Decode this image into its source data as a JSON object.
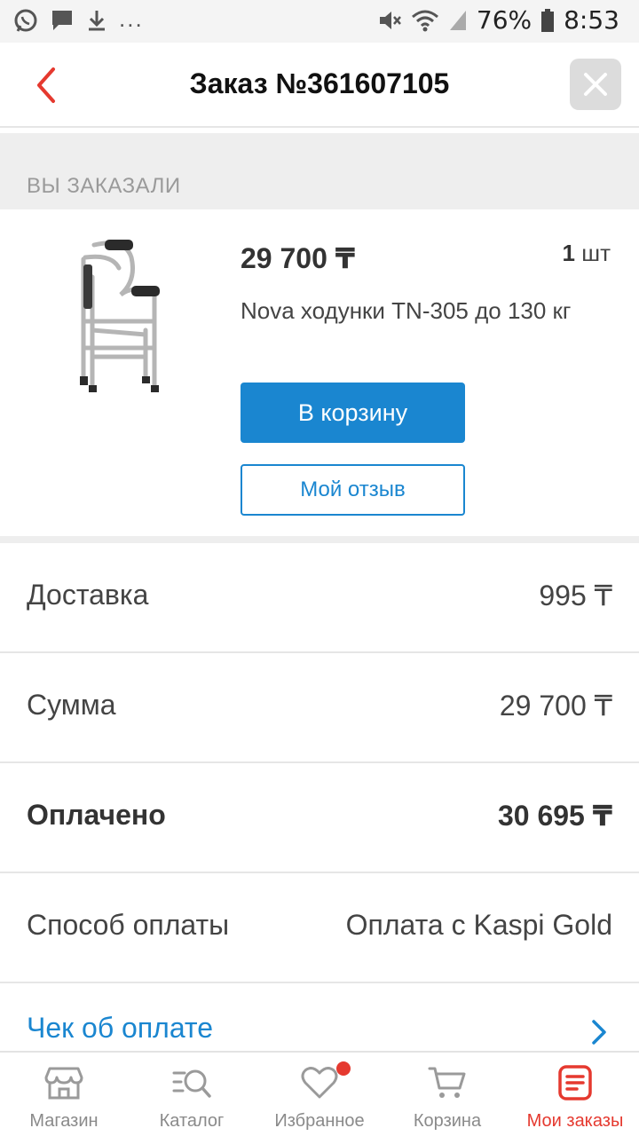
{
  "status_bar": {
    "battery": "76%",
    "time": "8:53",
    "more": "..."
  },
  "header": {
    "title": "Заказ №361607105"
  },
  "section": {
    "label": "ВЫ ЗАКАЗАЛИ"
  },
  "product": {
    "price": "29 700 ₸",
    "qty_number": "1",
    "qty_unit": "шт",
    "name": "Nova ходунки TN-305 до 130 кг",
    "cart_button": "В корзину",
    "review_button": "Мой отзыв"
  },
  "summary": [
    {
      "label": "Доставка",
      "value": "995 ₸"
    },
    {
      "label": "Сумма",
      "value": "29 700 ₸"
    },
    {
      "label": "Оплачено",
      "value": "30 695 ₸"
    },
    {
      "label": "Способ оплаты",
      "value": "Оплата с Kaspi Gold"
    }
  ],
  "receipt_link": "Чек об оплате",
  "bottom_nav": [
    {
      "label": "Магазин",
      "icon": "store-icon"
    },
    {
      "label": "Каталог",
      "icon": "catalog-search-icon"
    },
    {
      "label": "Избранное",
      "icon": "heart-icon"
    },
    {
      "label": "Корзина",
      "icon": "cart-icon"
    },
    {
      "label": "Мои заказы",
      "icon": "orders-icon"
    }
  ],
  "colors": {
    "accent_blue": "#1a86d0",
    "accent_red": "#e5392f",
    "background_gray": "#eeeeee"
  }
}
